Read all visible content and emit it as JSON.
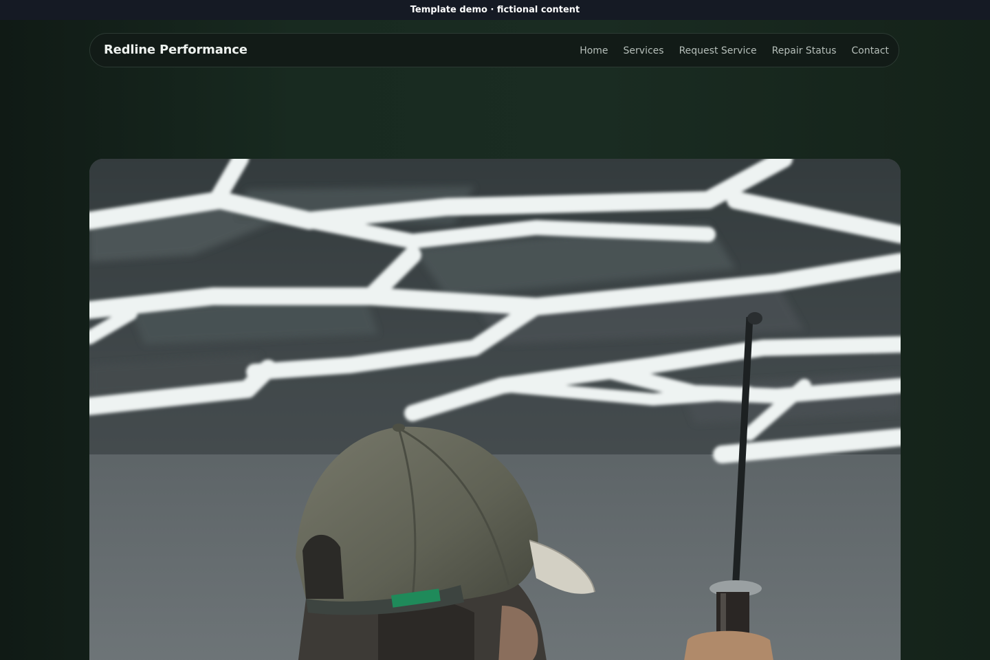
{
  "banner": {
    "text": "Template demo · fictional content"
  },
  "site": {
    "brand": "Redline Performance"
  },
  "nav": {
    "items": [
      {
        "label": "Home"
      },
      {
        "label": "Services"
      },
      {
        "label": "Request Service"
      },
      {
        "label": "Repair Status"
      },
      {
        "label": "Contact"
      }
    ]
  },
  "hero": {
    "image_subject": "mechanic in cap holding tool under hexagonal LED garage ceiling lights"
  },
  "colors": {
    "background": "#182a20",
    "banner": "#151a24",
    "nav_text": "#b6bfba",
    "brand_text": "#eef2ef"
  }
}
